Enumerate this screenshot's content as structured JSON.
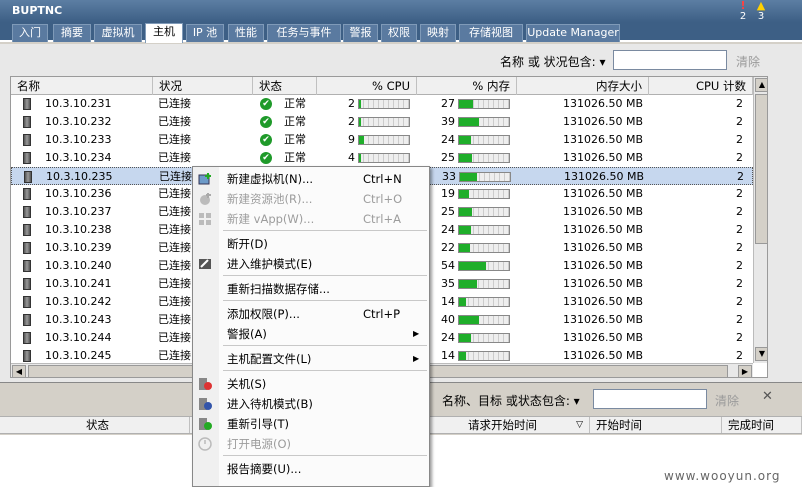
{
  "window": {
    "title": "BUPTNC",
    "alerts": [
      {
        "icon": "error-icon",
        "count": "2"
      },
      {
        "icon": "warning-icon",
        "count": "3"
      }
    ]
  },
  "tabs": [
    "入门",
    "摘要",
    "虚拟机",
    "主机",
    "IP 池",
    "性能",
    "任务与事件",
    "警报",
    "权限",
    "映射",
    "存储视图",
    "Update Manager"
  ],
  "active_tab": "主机",
  "filter": {
    "label": "名称 或 状况包含:",
    "value": "",
    "clear": "清除"
  },
  "columns": [
    "名称",
    "状况",
    "状态",
    "% CPU",
    "% 内存",
    "内存大小",
    "CPU 计数"
  ],
  "rows": [
    {
      "name": "10.3.10.231",
      "state": "已连接",
      "status": "正常",
      "cpu": "2",
      "mem": "27",
      "size": "131026.50 MB",
      "cpus": "2"
    },
    {
      "name": "10.3.10.232",
      "state": "已连接",
      "status": "正常",
      "cpu": "2",
      "mem": "39",
      "size": "131026.50 MB",
      "cpus": "2"
    },
    {
      "name": "10.3.10.233",
      "state": "已连接",
      "status": "正常",
      "cpu": "9",
      "mem": "24",
      "size": "131026.50 MB",
      "cpus": "2"
    },
    {
      "name": "10.3.10.234",
      "state": "已连接",
      "status": "正常",
      "cpu": "4",
      "mem": "25",
      "size": "131026.50 MB",
      "cpus": "2"
    },
    {
      "name": "10.3.10.235",
      "state": "已连接",
      "status": "",
      "cpu": "",
      "mem": "33",
      "size": "131026.50 MB",
      "cpus": "2",
      "selected": true
    },
    {
      "name": "10.3.10.236",
      "state": "已连接",
      "status": "",
      "cpu": "",
      "mem": "19",
      "size": "131026.50 MB",
      "cpus": "2"
    },
    {
      "name": "10.3.10.237",
      "state": "已连接",
      "status": "",
      "cpu": "",
      "mem": "25",
      "size": "131026.50 MB",
      "cpus": "2"
    },
    {
      "name": "10.3.10.238",
      "state": "已连接",
      "status": "",
      "cpu": "",
      "mem": "24",
      "size": "131026.50 MB",
      "cpus": "2"
    },
    {
      "name": "10.3.10.239",
      "state": "已连接",
      "status": "",
      "cpu": "",
      "mem": "22",
      "size": "131026.50 MB",
      "cpus": "2"
    },
    {
      "name": "10.3.10.240",
      "state": "已连接",
      "status": "",
      "cpu": "",
      "mem": "54",
      "size": "131026.50 MB",
      "cpus": "2"
    },
    {
      "name": "10.3.10.241",
      "state": "已连接",
      "status": "",
      "cpu": "",
      "mem": "35",
      "size": "131026.50 MB",
      "cpus": "2"
    },
    {
      "name": "10.3.10.242",
      "state": "已连接",
      "status": "",
      "cpu": "",
      "mem": "14",
      "size": "131026.50 MB",
      "cpus": "2"
    },
    {
      "name": "10.3.10.243",
      "state": "已连接",
      "status": "",
      "cpu": "",
      "mem": "40",
      "size": "131026.50 MB",
      "cpus": "2"
    },
    {
      "name": "10.3.10.244",
      "state": "已连接",
      "status": "",
      "cpu": "",
      "mem": "24",
      "size": "131026.50 MB",
      "cpus": "2"
    },
    {
      "name": "10.3.10.245",
      "state": "已连接",
      "status": "",
      "cpu": "",
      "mem": "14",
      "size": "131026.50 MB",
      "cpus": "2"
    }
  ],
  "context_menu": {
    "items": [
      {
        "label": "新建虚拟机(N)...",
        "shortcut": "Ctrl+N",
        "disabled": false,
        "icon": "new-vm-icon"
      },
      {
        "label": "新建资源池(R)...",
        "shortcut": "Ctrl+O",
        "disabled": true,
        "icon": "resource-pool-icon"
      },
      {
        "label": "新建 vApp(W)...",
        "shortcut": "Ctrl+A",
        "disabled": true,
        "icon": "vapp-icon"
      },
      {
        "label": "断开(D)",
        "shortcut": "",
        "disabled": false,
        "sep_before": true
      },
      {
        "label": "进入维护模式(E)",
        "shortcut": "",
        "disabled": false,
        "icon": "maintenance-icon"
      },
      {
        "label": "重新扫描数据存储...",
        "shortcut": "",
        "disabled": false,
        "sep_before": true
      },
      {
        "label": "添加权限(P)...",
        "shortcut": "Ctrl+P",
        "disabled": false,
        "sep_before": true
      },
      {
        "label": "警报(A)",
        "shortcut": "",
        "disabled": false,
        "submenu": true
      },
      {
        "label": "主机配置文件(L)",
        "shortcut": "",
        "disabled": false,
        "submenu": true,
        "sep_before": true
      },
      {
        "label": "关机(S)",
        "shortcut": "",
        "disabled": false,
        "icon": "shutdown-icon",
        "sep_before": true
      },
      {
        "label": "进入待机模式(B)",
        "shortcut": "",
        "disabled": false,
        "icon": "standby-icon"
      },
      {
        "label": "重新引导(T)",
        "shortcut": "",
        "disabled": false,
        "icon": "reboot-icon"
      },
      {
        "label": "打开电源(O)",
        "shortcut": "",
        "disabled": true,
        "icon": "power-on-icon"
      },
      {
        "label": "报告摘要(U)...",
        "shortcut": "",
        "disabled": false,
        "sep_before": true
      }
    ]
  },
  "tasks_panel": {
    "filter_label": "名称、目标 或状态包含:",
    "filter_value": "",
    "clear": "清除",
    "columns": [
      "状态",
      "请求开始时间",
      "开始时间",
      "完成时间"
    ]
  },
  "watermark": "www.wooyun.org"
}
